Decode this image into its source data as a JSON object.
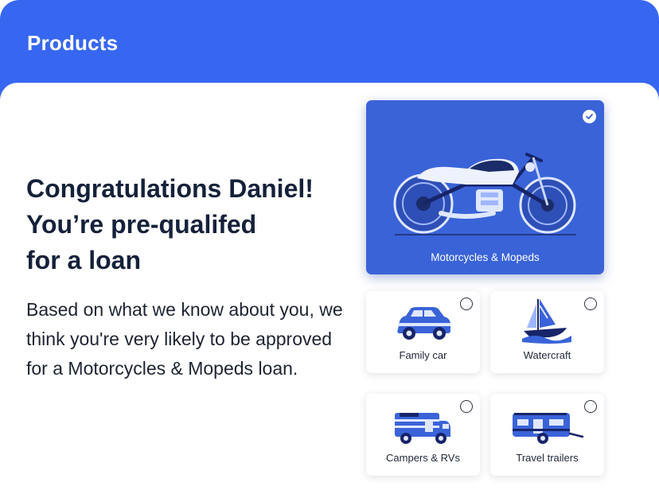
{
  "header": {
    "title": "Products"
  },
  "intro": {
    "headline_lines": [
      "Congratulations Daniel!",
      "You’re pre-qualifed",
      "for a loan"
    ],
    "body": "Based on what we know about you, we think you're very likely to be approved for a Motorcycles & Mopeds loan."
  },
  "products": [
    {
      "label": "Motorcycles & Mopeds",
      "selected": true,
      "icon": "motorcycle-icon"
    },
    {
      "label": "Family car",
      "selected": false,
      "icon": "car-icon"
    },
    {
      "label": "Watercraft",
      "selected": false,
      "icon": "sailboat-icon"
    },
    {
      "label": "Campers & RVs",
      "selected": false,
      "icon": "camper-icon"
    },
    {
      "label": "Travel trailers",
      "selected": false,
      "icon": "trailer-icon"
    }
  ],
  "colors": {
    "brand": "#3767f1",
    "selected_card": "#3a63d8",
    "text_dark": "#15213a"
  }
}
